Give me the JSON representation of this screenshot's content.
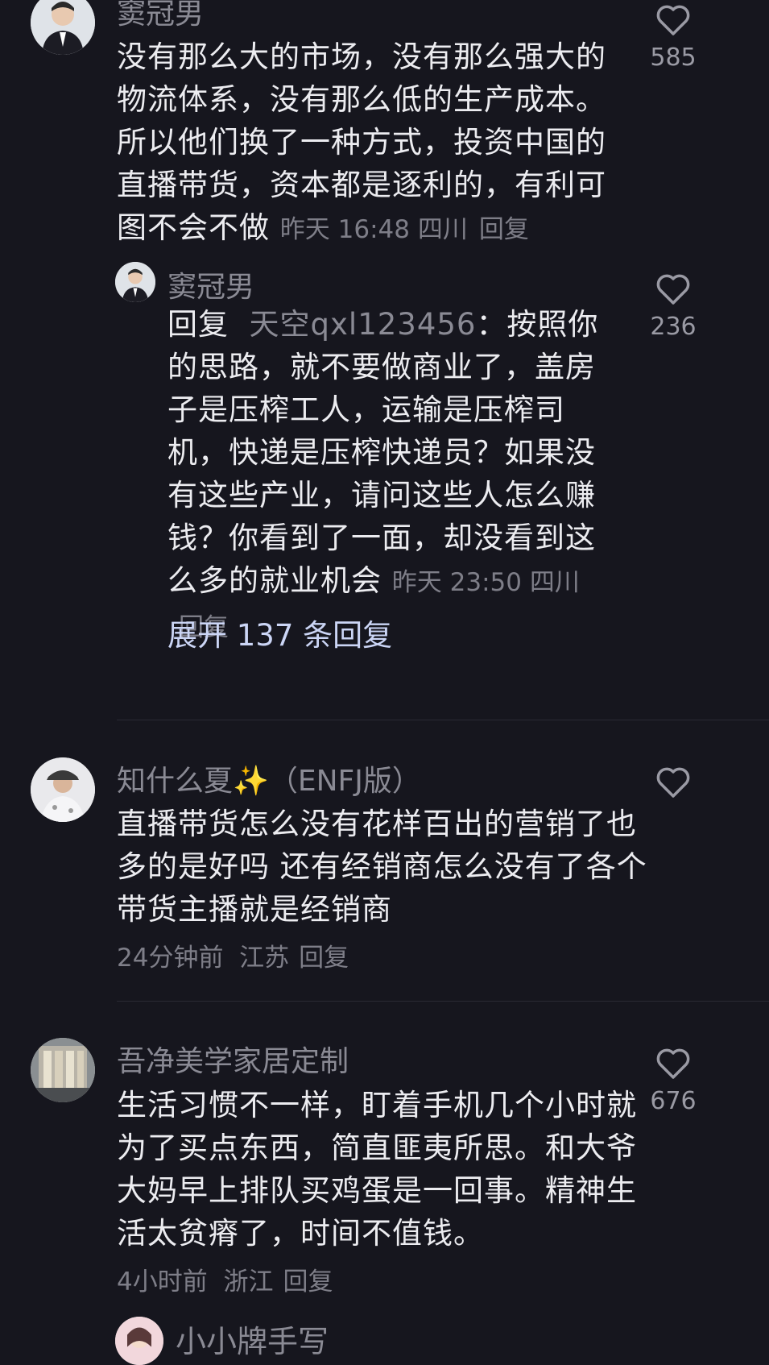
{
  "comments": [
    {
      "author": "窦冠男",
      "text": "没有那么大的市场，没有那么强大的物流体系，没有那么低的生产成本。所以他们换了一种方式，投资中国的直播带货，资本都是逐利的，有利可图不会不做",
      "time": "昨天 16:48",
      "location": "四川",
      "reply_label": "回复",
      "likes": "585",
      "sub_reply": {
        "author": "窦冠男",
        "prefix": "回复",
        "reply_to": "天空qxl123456",
        "text": "：按照你的思路，就不要做商业了，盖房子是压榨工人，运输是压榨司机，快递是压榨快递员？如果没有这些产业，请问这些人怎么赚钱？你看到了一面，却没看到这么多的就业机会",
        "time": "昨天 23:50",
        "location": "四川",
        "reply_label": "回复",
        "likes": "236"
      },
      "expand_label": "展开 137 条回复"
    },
    {
      "author": "知什么夏✨（ENFJ版）",
      "text": "直播带货怎么没有花样百出的营销了也多的是好吗 还有经销商怎么没有了各个带货主播就是经销商",
      "time": "24分钟前",
      "location": "江苏",
      "reply_label": "回复",
      "likes": ""
    },
    {
      "author": "吾净美学家居定制",
      "text": "生活习惯不一样，盯着手机几个小时就为了买点东西，简直匪夷所思。和大爷大妈早上排队买鸡蛋是一回事。精神生活太贫瘠了，时间不值钱。",
      "time": "4小时前",
      "location": "浙江",
      "reply_label": "回复",
      "likes": "676"
    },
    {
      "author": "小小牌手写"
    }
  ],
  "colors": {
    "background": "#16161e",
    "text": "#ececf0",
    "muted": "#7e7e88",
    "expand": "#cbd5f5"
  }
}
